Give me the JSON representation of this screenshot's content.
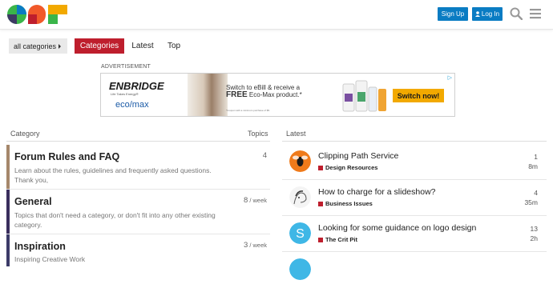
{
  "header": {
    "signup_label": "Sign Up",
    "login_label": "Log In",
    "brand_colors": [
      "#f1592a",
      "#0a7cc3",
      "#be1e2d",
      "#f2a900",
      "#3ab54a"
    ]
  },
  "nav": {
    "category_dropdown": "all categories",
    "tabs": [
      {
        "label": "Categories",
        "active": true
      },
      {
        "label": "Latest",
        "active": false
      },
      {
        "label": "Top",
        "active": false
      }
    ]
  },
  "ad": {
    "label": "ADVERTISEMENT",
    "brand": "ENBRIDGE",
    "brand_tagline": "Life Takes Energy®",
    "partner": "eco/max",
    "copy_line1": "Switch to eBill & receive a",
    "copy_line2": "FREE",
    "copy_line3": "Eco-Max product.*",
    "fine_print": "*Coupon with a minimum purchase of $5.",
    "cta": "Switch now!",
    "adchoices": "▷"
  },
  "categories": {
    "col_category": "Category",
    "col_topics": "Topics",
    "rows": [
      {
        "name": "Forum Rules and FAQ",
        "description": "Learn about the rules, guidelines and frequently asked questions. Thank you,",
        "count": "4",
        "period": "",
        "color": "#a5876b"
      },
      {
        "name": "General",
        "description": "Topics that don't need a category, or don't fit into any other existing category.",
        "count": "8",
        "period": " / week",
        "color": "#3a2e5d"
      },
      {
        "name": "Inspiration",
        "description": "Inspiring Creative Work",
        "count": "3",
        "period": " / week",
        "color": "#3c3b68"
      }
    ]
  },
  "latest": {
    "header": "Latest",
    "topics": [
      {
        "title": "Clipping Path Service",
        "category": "Design Resources",
        "category_color": "#be1e2d",
        "posts": "1",
        "age": "8m",
        "avatar": "orange-bee"
      },
      {
        "title": "How to charge for a slideshow?",
        "category": "Business Issues",
        "category_color": "#be1e2d",
        "posts": "4",
        "age": "35m",
        "avatar": "sketch-portrait"
      },
      {
        "title": "Looking for some guidance on logo design",
        "category": "The Crit Pit",
        "category_color": "#be1e2d",
        "posts": "13",
        "age": "2h",
        "avatar": "S"
      }
    ]
  }
}
